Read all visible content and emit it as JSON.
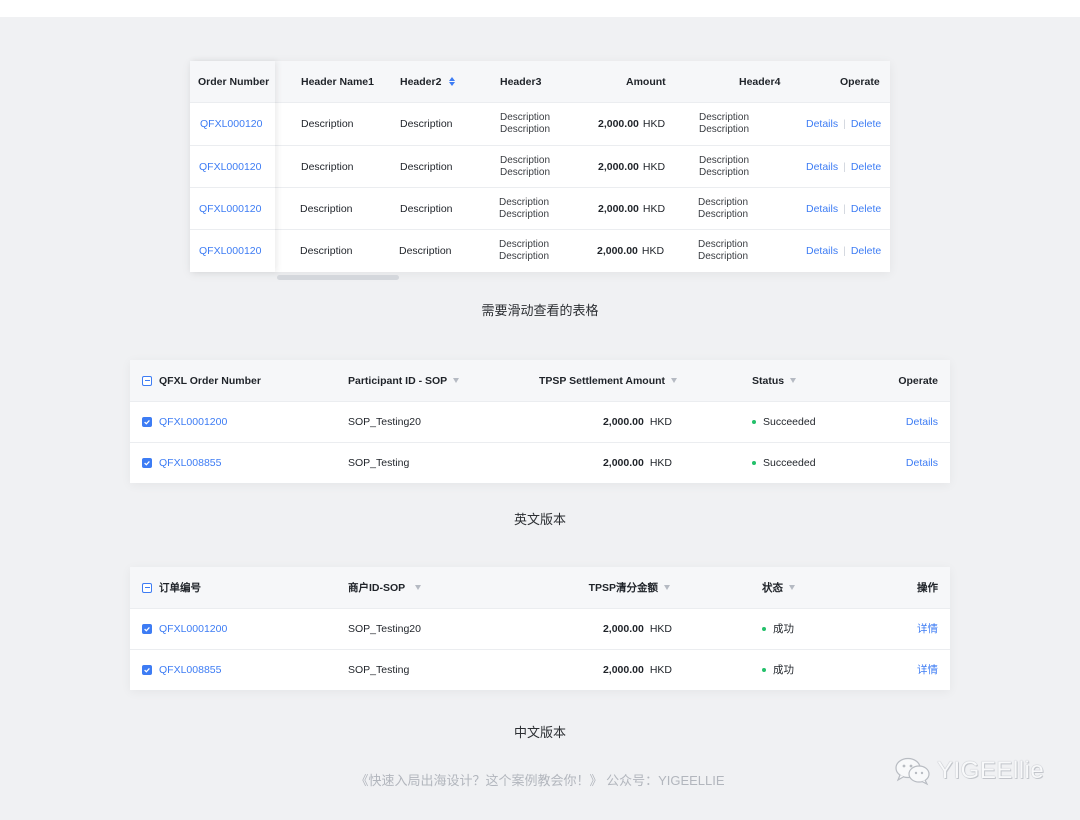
{
  "table1": {
    "headers": {
      "order": "Order Number",
      "name": "Header Name1",
      "h2": "Header2",
      "h3": "Header3",
      "amount": "Amount",
      "h4": "Header4",
      "operate": "Operate"
    },
    "rows": [
      {
        "order": "QFXL000120",
        "name": "Description",
        "h2": "Description",
        "h3a": "Description",
        "h3b": "Description",
        "amount": "2,000.00",
        "currency": "HKD",
        "h4a": "Description",
        "h4b": "Description",
        "details": "Details",
        "delete": "Delete"
      },
      {
        "order": "QFXL000120",
        "name": "Description",
        "h2": "Description",
        "h3a": "Description",
        "h3b": "Description",
        "amount": "2,000.00",
        "currency": "HKD",
        "h4a": "Description",
        "h4b": "Description",
        "details": "Details",
        "delete": "Delete"
      },
      {
        "order": "QFXL000120",
        "name": "Description",
        "h2": "Description",
        "h3a": "Description",
        "h3b": "Description",
        "amount": "2,000.00",
        "currency": "HKD",
        "h4a": "Description",
        "h4b": "Description",
        "details": "Details",
        "delete": "Delete"
      },
      {
        "order": "QFXL000120",
        "name": "Description",
        "h2": "Description",
        "h3a": "Description",
        "h3b": "Description",
        "amount": "2,000.00",
        "currency": "HKD",
        "h4a": "Description",
        "h4b": "Description",
        "details": "Details",
        "delete": "Delete"
      }
    ],
    "caption": "需要滑动查看的表格"
  },
  "table_en": {
    "headers": {
      "order": "QFXL Order Number",
      "participant": "Participant ID - SOP",
      "amount": "TPSP Settlement Amount",
      "status": "Status",
      "operate": "Operate"
    },
    "rows": [
      {
        "order": "QFXL0001200",
        "participant": "SOP_Testing20",
        "amount": "2,000.00",
        "currency": "HKD",
        "status": "Succeeded",
        "op": "Details"
      },
      {
        "order": "QFXL008855",
        "participant": "SOP_Testing",
        "amount": "2,000.00",
        "currency": "HKD",
        "status": "Succeeded",
        "op": "Details"
      }
    ],
    "caption": "英文版本"
  },
  "table_cn": {
    "headers": {
      "order": "订单编号",
      "participant": "商户ID-SOP",
      "amount": "TPSP清分金额",
      "status": "状态",
      "operate": "操作"
    },
    "rows": [
      {
        "order": "QFXL0001200",
        "participant": "SOP_Testing20",
        "amount": "2,000.00",
        "currency": "HKD",
        "status": "成功",
        "op": "详情"
      },
      {
        "order": "QFXL008855",
        "participant": "SOP_Testing",
        "amount": "2,000.00",
        "currency": "HKD",
        "status": "成功",
        "op": "详情"
      }
    ],
    "caption": "中文版本"
  },
  "footer": {
    "text": "《快速入局出海设计？这个案例教会你！》 公众号：YIGEELLIE",
    "watermark": "YIGEEllie"
  },
  "colors": {
    "link": "#3d7cf4",
    "success": "#23c06a",
    "header_bg": "#f6f7f9",
    "page_bg": "#f0f1f3"
  },
  "icons": [
    "sort-icon",
    "filter-icon",
    "checkbox-icon",
    "wechat-icon"
  ]
}
